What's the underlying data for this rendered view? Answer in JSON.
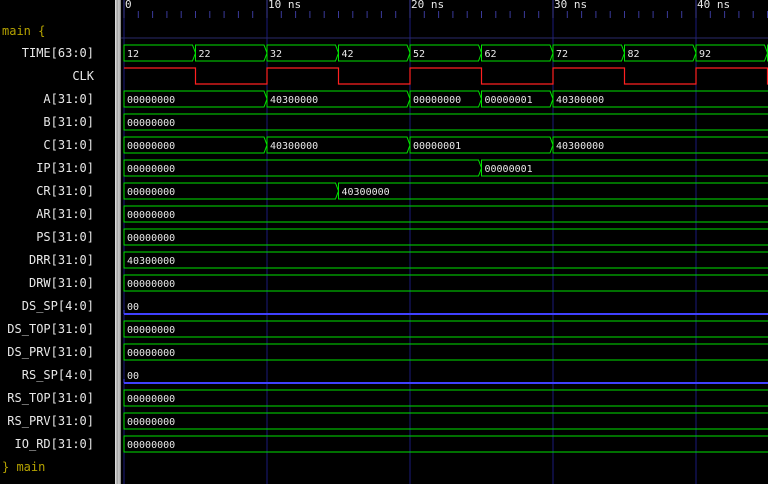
{
  "groups": {
    "open_label": "main {",
    "close_label": "} main"
  },
  "timescale": {
    "t_start": 0,
    "t_end": 45,
    "major_step": 10,
    "minor_step": 1,
    "unit": "ns",
    "major_labels": [
      "0",
      "10 ns",
      "20 ns",
      "30 ns",
      "40 ns"
    ]
  },
  "colors": {
    "bus": "#00e000",
    "clock": "#ff2020",
    "narrow_bus": "#4040ff",
    "major_grid": "#1a1a7a",
    "text": "#e8e8e8",
    "group_text": "#b5a200"
  },
  "signals": [
    {
      "name": "TIME[63:0]",
      "kind": "bus",
      "segments": [
        {
          "t": 0,
          "value": "12"
        },
        {
          "t": 5,
          "value": "22"
        },
        {
          "t": 10,
          "value": "32"
        },
        {
          "t": 15,
          "value": "42"
        },
        {
          "t": 20,
          "value": "52"
        },
        {
          "t": 25,
          "value": "62"
        },
        {
          "t": 30,
          "value": "72"
        },
        {
          "t": 35,
          "value": "82"
        },
        {
          "t": 40,
          "value": "92"
        },
        {
          "t": 45,
          "value": ""
        }
      ]
    },
    {
      "name": "CLK",
      "kind": "clock",
      "transitions": [
        {
          "t": 0,
          "level": 1
        },
        {
          "t": 5,
          "level": 0
        },
        {
          "t": 10,
          "level": 1
        },
        {
          "t": 15,
          "level": 0
        },
        {
          "t": 20,
          "level": 1
        },
        {
          "t": 25,
          "level": 0
        },
        {
          "t": 30,
          "level": 1
        },
        {
          "t": 35,
          "level": 0
        },
        {
          "t": 40,
          "level": 1
        },
        {
          "t": 45,
          "level": 0
        }
      ]
    },
    {
      "name": "A[31:0]",
      "kind": "bus",
      "segments": [
        {
          "t": 0,
          "value": "00000000"
        },
        {
          "t": 10,
          "value": "40300000"
        },
        {
          "t": 20,
          "value": "00000000"
        },
        {
          "t": 25,
          "value": "00000001"
        },
        {
          "t": 30,
          "value": "40300000"
        }
      ]
    },
    {
      "name": "B[31:0]",
      "kind": "bus",
      "segments": [
        {
          "t": 0,
          "value": "00000000"
        }
      ]
    },
    {
      "name": "C[31:0]",
      "kind": "bus",
      "segments": [
        {
          "t": 0,
          "value": "00000000"
        },
        {
          "t": 10,
          "value": "40300000"
        },
        {
          "t": 20,
          "value": "00000001"
        },
        {
          "t": 30,
          "value": "40300000"
        }
      ]
    },
    {
      "name": "IP[31:0]",
      "kind": "bus",
      "segments": [
        {
          "t": 0,
          "value": "00000000"
        },
        {
          "t": 25,
          "value": "00000001"
        }
      ]
    },
    {
      "name": "CR[31:0]",
      "kind": "bus",
      "segments": [
        {
          "t": 0,
          "value": "00000000"
        },
        {
          "t": 15,
          "value": "40300000"
        }
      ]
    },
    {
      "name": "AR[31:0]",
      "kind": "bus",
      "segments": [
        {
          "t": 0,
          "value": "00000000"
        }
      ]
    },
    {
      "name": "PS[31:0]",
      "kind": "bus",
      "segments": [
        {
          "t": 0,
          "value": "00000000"
        }
      ]
    },
    {
      "name": "DRR[31:0]",
      "kind": "bus",
      "segments": [
        {
          "t": 0,
          "value": "40300000"
        }
      ]
    },
    {
      "name": "DRW[31:0]",
      "kind": "bus",
      "segments": [
        {
          "t": 0,
          "value": "00000000"
        }
      ]
    },
    {
      "name": "DS_SP[4:0]",
      "kind": "narrow",
      "segments": [
        {
          "t": 0,
          "value": "00"
        }
      ]
    },
    {
      "name": "DS_TOP[31:0]",
      "kind": "bus",
      "segments": [
        {
          "t": 0,
          "value": "00000000"
        }
      ]
    },
    {
      "name": "DS_PRV[31:0]",
      "kind": "bus",
      "segments": [
        {
          "t": 0,
          "value": "00000000"
        }
      ]
    },
    {
      "name": "RS_SP[4:0]",
      "kind": "narrow",
      "segments": [
        {
          "t": 0,
          "value": "00"
        }
      ]
    },
    {
      "name": "RS_TOP[31:0]",
      "kind": "bus",
      "segments": [
        {
          "t": 0,
          "value": "00000000"
        }
      ]
    },
    {
      "name": "RS_PRV[31:0]",
      "kind": "bus",
      "segments": [
        {
          "t": 0,
          "value": "00000000"
        }
      ]
    },
    {
      "name": "IO_RD[31:0]",
      "kind": "bus",
      "segments": [
        {
          "t": 0,
          "value": "00000000"
        }
      ]
    }
  ]
}
